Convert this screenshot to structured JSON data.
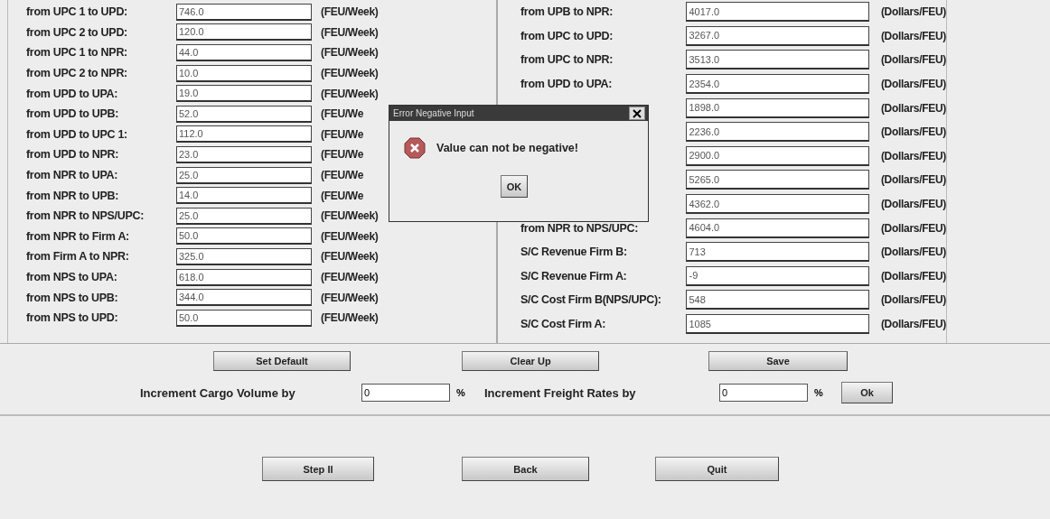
{
  "left_rows": [
    {
      "label": "from UPC 1 to UPD:",
      "value": "746.0",
      "unit": "(FEU/Week)"
    },
    {
      "label": "from UPC 2 to UPD:",
      "value": "120.0",
      "unit": "(FEU/Week)"
    },
    {
      "label": "from UPC 1 to NPR:",
      "value": "44.0",
      "unit": "(FEU/Week)"
    },
    {
      "label": "from UPC 2 to NPR:",
      "value": "10.0",
      "unit": "(FEU/Week)"
    },
    {
      "label": "from UPD to UPA:",
      "value": "19.0",
      "unit": "(FEU/Week)"
    },
    {
      "label": "from UPD to UPB:",
      "value": "52.0",
      "unit": "(FEU/We"
    },
    {
      "label": "from UPD to UPC 1:",
      "value": "112.0",
      "unit": "(FEU/We"
    },
    {
      "label": "from UPD to NPR:",
      "value": "23.0",
      "unit": "(FEU/We"
    },
    {
      "label": "from NPR to UPA:",
      "value": "25.0",
      "unit": "(FEU/We"
    },
    {
      "label": "from NPR to UPB:",
      "value": "14.0",
      "unit": "(FEU/We"
    },
    {
      "label": "from NPR to NPS/UPC:",
      "value": "25.0",
      "unit": "(FEU/Week)"
    },
    {
      "label": "from NPR to Firm A:",
      "value": "50.0",
      "unit": "(FEU/Week)"
    },
    {
      "label": "from Firm A to NPR:",
      "value": "325.0",
      "unit": "(FEU/Week)"
    },
    {
      "label": "from NPS to UPA:",
      "value": "618.0",
      "unit": "(FEU/Week)"
    },
    {
      "label": "from NPS to UPB:",
      "value": "344.0",
      "unit": "(FEU/Week)"
    },
    {
      "label": "from NPS to UPD:",
      "value": "50.0",
      "unit": "(FEU/Week)"
    }
  ],
  "right_rows": [
    {
      "label": "from UPB to NPR:",
      "value": "4017.0",
      "unit": "(Dollars/FEU)"
    },
    {
      "label": "from UPC to UPD:",
      "value": "3267.0",
      "unit": "(Dollars/FEU)"
    },
    {
      "label": "from UPC to NPR:",
      "value": "3513.0",
      "unit": "(Dollars/FEU)"
    },
    {
      "label": "from UPD to UPA:",
      "value": "2354.0",
      "unit": "(Dollars/FEU)"
    },
    {
      "value": "1898.0",
      "unit": "(Dollars/FEU)"
    },
    {
      "value": "2236.0",
      "unit": "(Dollars/FEU)"
    },
    {
      "value": "2900.0",
      "unit": "(Dollars/FEU)"
    },
    {
      "value": "5265.0",
      "unit": "(Dollars/FEU)"
    },
    {
      "value": "4362.0",
      "unit": "(Dollars/FEU)"
    },
    {
      "label": "from NPR to NPS/UPC:",
      "value": "4604.0",
      "unit": "(Dollars/FEU)"
    },
    {
      "label": "S/C Revenue Firm B:",
      "value": "713",
      "unit": "(Dollars/FEU)"
    },
    {
      "label": "S/C Revenue Firm A:",
      "value": "-9",
      "unit": "(Dollars/FEU)"
    },
    {
      "label": "S/C Cost Firm B(NPS/UPC):",
      "value": "548",
      "unit": "(Dollars/FEU)"
    },
    {
      "label": "S/C Cost Firm A:",
      "value": "1085",
      "unit": "(Dollars/FEU)"
    }
  ],
  "action_buttons": [
    "Set Default",
    "Clear Up",
    "Save"
  ],
  "increments": [
    {
      "label": "Increment Cargo Volume by",
      "value": "0",
      "unit": "%"
    },
    {
      "label": "Increment Freight Rates by",
      "value": "0",
      "unit": "%"
    }
  ],
  "ok_button": "Ok",
  "nav_buttons": [
    "Step II",
    "Back",
    "Quit"
  ],
  "dialog": {
    "title": "Error Negative Input",
    "message": "Value can not be negative!",
    "button": "OK"
  }
}
